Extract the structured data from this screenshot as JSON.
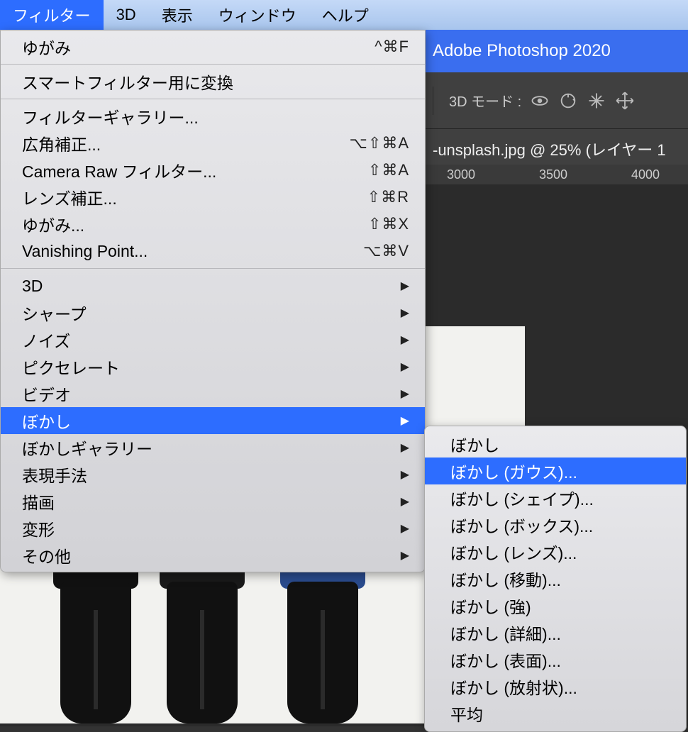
{
  "menubar": {
    "filter": "フィルター",
    "three_d": "3D",
    "view": "表示",
    "window": "ウィンドウ",
    "help": "ヘルプ"
  },
  "app_title": "Adobe Photoshop 2020",
  "toolbar": {
    "mode_label": "3D モード :"
  },
  "document": {
    "tab_label": "-unsplash.jpg @ 25% (レイヤー 1",
    "ruler": {
      "t1": "3000",
      "t2": "3500",
      "t3": "4000"
    }
  },
  "filter_menu": {
    "group1": [
      {
        "label": "ゆがみ",
        "shortcut": "^⌘F"
      }
    ],
    "group2": [
      {
        "label": "スマートフィルター用に変換"
      }
    ],
    "group3": [
      {
        "label": "フィルターギャラリー..."
      },
      {
        "label": "広角補正...",
        "shortcut": "⌥⇧⌘A"
      },
      {
        "label": "Camera Raw フィルター...",
        "shortcut": "⇧⌘A"
      },
      {
        "label": "レンズ補正...",
        "shortcut": "⇧⌘R"
      },
      {
        "label": "ゆがみ...",
        "shortcut": "⇧⌘X"
      },
      {
        "label": "Vanishing Point...",
        "shortcut": "⌥⌘V"
      }
    ],
    "group4": [
      {
        "label": "3D",
        "submenu": true
      },
      {
        "label": "シャープ",
        "submenu": true
      },
      {
        "label": "ノイズ",
        "submenu": true
      },
      {
        "label": "ピクセレート",
        "submenu": true
      },
      {
        "label": "ビデオ",
        "submenu": true
      },
      {
        "label": "ぼかし",
        "submenu": true,
        "highlight": true
      },
      {
        "label": "ぼかしギャラリー",
        "submenu": true
      },
      {
        "label": "表現手法",
        "submenu": true
      },
      {
        "label": "描画",
        "submenu": true
      },
      {
        "label": "変形",
        "submenu": true
      },
      {
        "label": "その他",
        "submenu": true
      }
    ]
  },
  "blur_submenu": [
    {
      "label": "ぼかし"
    },
    {
      "label": "ぼかし (ガウス)...",
      "highlight": true
    },
    {
      "label": "ぼかし (シェイプ)..."
    },
    {
      "label": "ぼかし (ボックス)..."
    },
    {
      "label": "ぼかし (レンズ)..."
    },
    {
      "label": "ぼかし (移動)..."
    },
    {
      "label": "ぼかし (強)"
    },
    {
      "label": "ぼかし (詳細)..."
    },
    {
      "label": "ぼかし (表面)..."
    },
    {
      "label": "ぼかし (放射状)..."
    },
    {
      "label": "平均"
    }
  ]
}
